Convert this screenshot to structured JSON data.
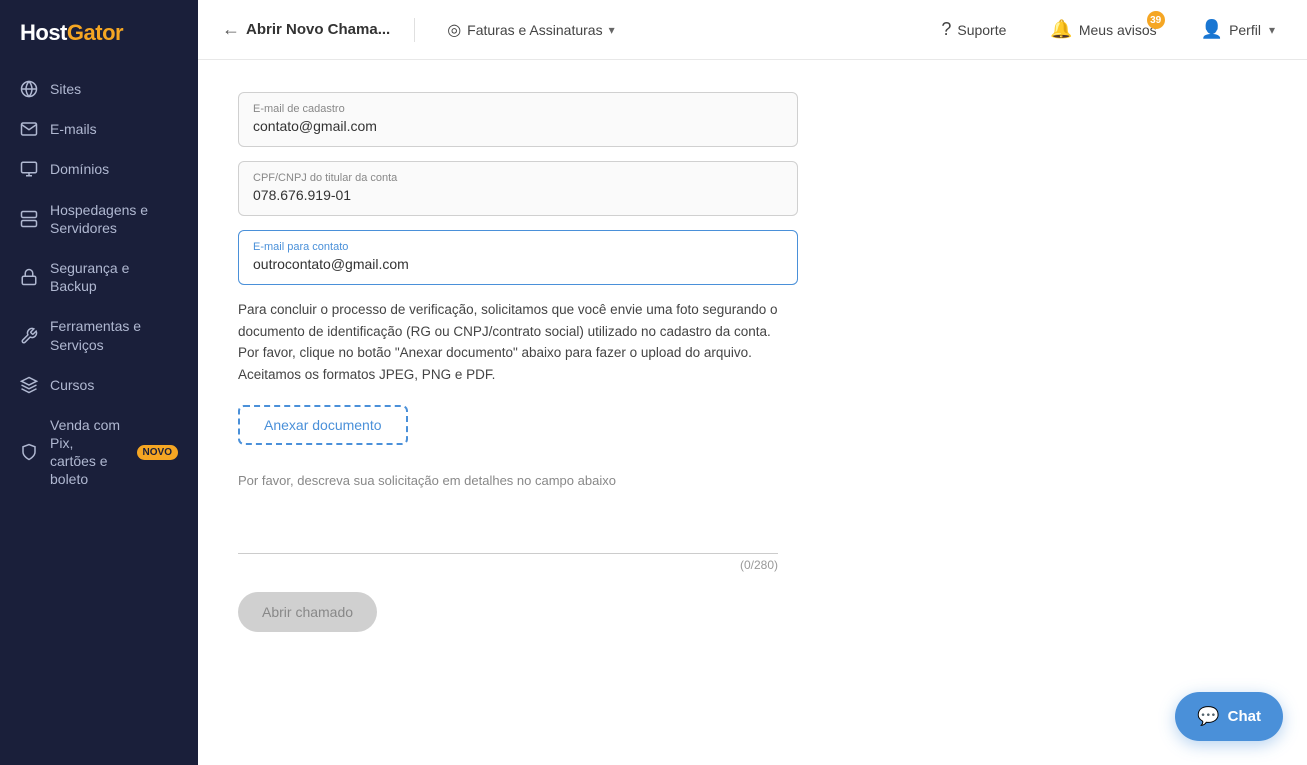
{
  "sidebar": {
    "logo": "HostGator",
    "items": [
      {
        "id": "sites",
        "label": "Sites",
        "icon": "globe"
      },
      {
        "id": "emails",
        "label": "E-mails",
        "icon": "email"
      },
      {
        "id": "domains",
        "label": "Domínios",
        "icon": "domain"
      },
      {
        "id": "hosting",
        "label": "Hospedagens e Servidores",
        "icon": "server"
      },
      {
        "id": "security",
        "label": "Segurança e Backup",
        "icon": "lock"
      },
      {
        "id": "tools",
        "label": "Ferramentas e Serviços",
        "icon": "tools"
      },
      {
        "id": "courses",
        "label": "Cursos",
        "icon": "courses"
      },
      {
        "id": "sell",
        "label": "Venda com Pix, cartões e boleto",
        "icon": "sell",
        "badge": "NOVO"
      }
    ]
  },
  "header": {
    "back_label": "Abrir Novo Chama...",
    "billing_label": "Faturas e Assinaturas",
    "support_label": "Suporte",
    "notifications_label": "Meus avisos",
    "notifications_count": "39",
    "profile_label": "Perfil"
  },
  "form": {
    "email_label": "E-mail de cadastro",
    "email_value": "contato@gmail.com",
    "cpf_label": "CPF/CNPJ do titular da conta",
    "cpf_value": "078.676.919-01",
    "contact_email_label": "E-mail para contato",
    "contact_email_value": "outrocontato@gmail.com",
    "info_text": "Para concluir o processo de verificação, solicitamos que você envie uma foto segurando o documento de identificação (RG ou CNPJ/contrato social) utilizado no cadastro da conta. Por favor, clique no botão \"Anexar documento\" abaixo para fazer o upload do arquivo. Aceitamos os formatos JPEG, PNG e PDF.",
    "attach_label": "Anexar documento",
    "textarea_placeholder": "Por favor, descreva sua solicitação em detalhes no campo abaixo",
    "char_count": "(0/280)",
    "submit_label": "Abrir chamado"
  },
  "chat": {
    "label": "Chat"
  }
}
